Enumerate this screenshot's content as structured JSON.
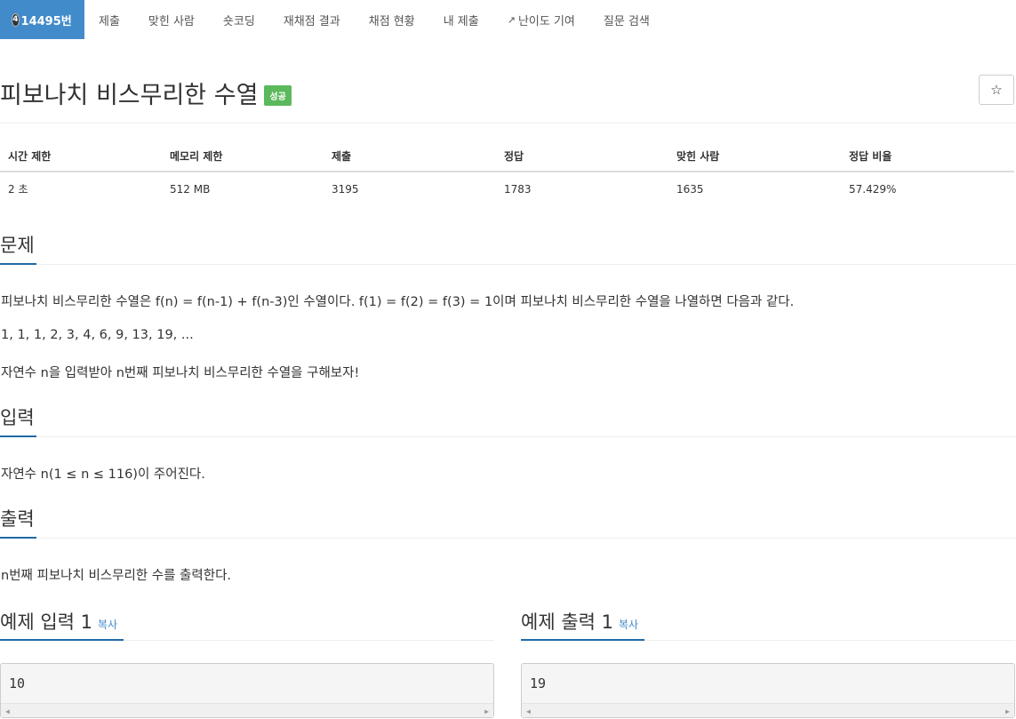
{
  "nav": {
    "problem_tier": "4",
    "problem_id": "14495번",
    "items": [
      "제출",
      "맞힌 사람",
      "숏코딩",
      "재채점 결과",
      "채점 현황",
      "내 제출",
      "난이도 기여",
      "질문 검색"
    ]
  },
  "title": {
    "text": "피보나치 비스무리한 수열",
    "status": "성공",
    "star": "☆"
  },
  "info": {
    "headers": [
      "시간 제한",
      "메모리 제한",
      "제출",
      "정답",
      "맞힌 사람",
      "정답 비율"
    ],
    "values": [
      "2 초",
      "512 MB",
      "3195",
      "1783",
      "1635",
      "57.429%"
    ]
  },
  "sections": {
    "problem_title": "문제",
    "problem_lines": [
      "피보나치 비스무리한 수열은 f(n) = f(n-1) + f(n-3)인 수열이다. f(1) = f(2) = f(3) = 1이며 피보나치 비스무리한 수열을 나열하면 다음과 같다.",
      "1, 1, 1, 2, 3, 4, 6, 9, 13, 19, ...",
      "자연수 n을 입력받아 n번째 피보나치 비스무리한 수열을 구해보자!"
    ],
    "input_title": "입력",
    "input_text": "자연수 n(1 ≤ n ≤ 116)이 주어진다.",
    "output_title": "출력",
    "output_text": "n번째 피보나치 비스무리한 수를 출력한다."
  },
  "samples": {
    "input_title": "예제 입력 1",
    "output_title": "예제 출력 1",
    "copy_label": "복사",
    "input_value": "10",
    "output_value": "19"
  },
  "colors": {
    "nav_active": "#428bca",
    "status_success": "#5cb85c",
    "section_underline": "#1f6aa5",
    "link": "#428bca"
  }
}
